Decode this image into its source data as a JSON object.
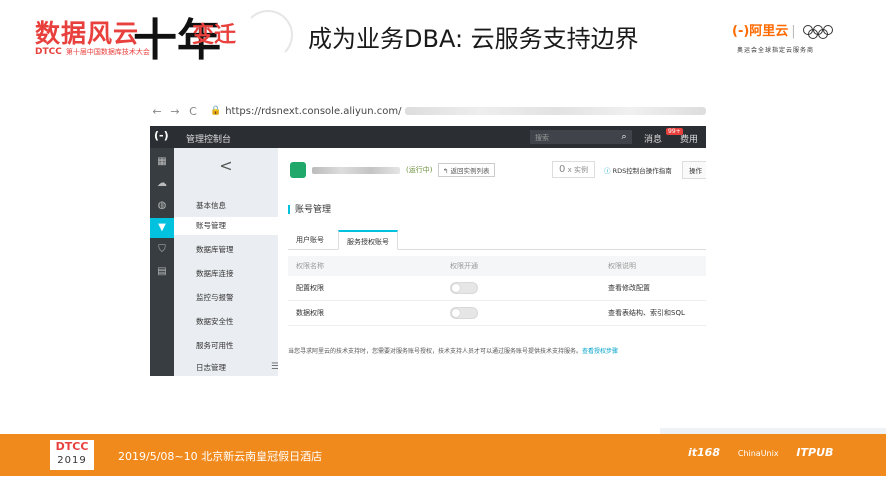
{
  "slide": {
    "logo_main": "数据风云",
    "logo_sub": "DTCC",
    "logo_sub_text": "第十届中国数据库技术大会",
    "logo_brush": "十年",
    "logo_change": "变迁",
    "title": "成为业务DBA:  云服务支持边界",
    "aliyun_logo": "(-)阿里云",
    "aliyun_sub": "奥运会全球指定云服务商"
  },
  "browser": {
    "back": "←",
    "forward": "→",
    "reload": "C",
    "lock": "🔒",
    "url": "https://rdsnext.console.aliyun.com/"
  },
  "console": {
    "topbar": {
      "logo": "(-)",
      "title": "管理控制台",
      "search_placeholder": "搜索",
      "search_icon": "search-icon",
      "messages": "消息",
      "badge": "99+",
      "fee": "费用"
    },
    "rail_icons": [
      "grid-icon",
      "cloud-icon",
      "globe-icon",
      "database-icon",
      "shield-icon",
      "list-icon"
    ],
    "subnav": {
      "back": "<",
      "items": [
        {
          "label": "基本信息"
        },
        {
          "label": "账号管理"
        },
        {
          "label": "数据库管理"
        },
        {
          "label": "数据库连接"
        },
        {
          "label": "监控与报警"
        },
        {
          "label": "数据安全性"
        },
        {
          "label": "服务可用性"
        },
        {
          "label": "日志管理"
        }
      ],
      "collapse": "☰"
    },
    "instance": {
      "status": "(运行中)",
      "back_to_list": "↰ 返回实例列表",
      "tasks_count": "0",
      "tasks_label": "x 实例",
      "guide_icon": "ⓘ",
      "guide": "RDS控制台操作指南",
      "ops": "操作"
    },
    "section_title": "账号管理",
    "tabs": [
      {
        "label": "用户账号"
      },
      {
        "label": "服务授权账号"
      }
    ],
    "table": {
      "headers": [
        "权限名称",
        "权限开通",
        "权限说明"
      ],
      "rows": [
        {
          "name": "配置权限",
          "desc": "查看修改配置"
        },
        {
          "name": "数据权限",
          "desc": "查看表结构、索引和SQL"
        }
      ]
    },
    "note": "当您寻求阿里云的技术支持时，您需要对服务账号授权，技术支持人员才可以通过服务账号提供技术支持服务。",
    "note_link": "查看授权步骤"
  },
  "footer": {
    "logo_line1": "DTCC",
    "logo_line2": "2019",
    "date_location": "2019/5/08~10  北京新云南皇冠假日酒店",
    "sponsor1": "it168",
    "sponsor2": "ChinaUnix",
    "sponsor3": "ITPUB"
  }
}
